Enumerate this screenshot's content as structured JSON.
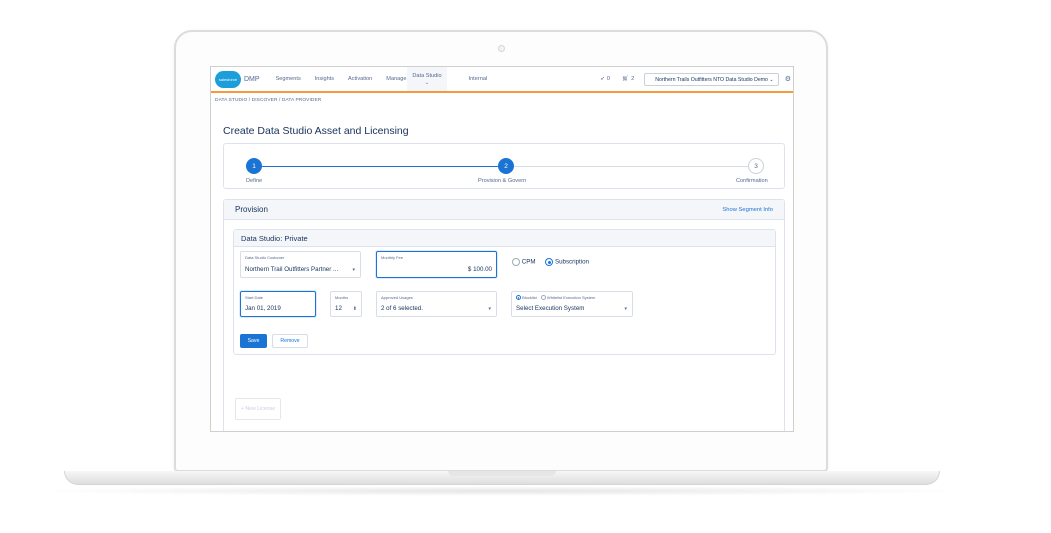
{
  "nav": {
    "app_name": "DMP",
    "logo_text": "salesforce",
    "items": [
      "Segments",
      "Insights",
      "Activation",
      "Manage"
    ],
    "active_item": "Data Studio",
    "after_active": "Internal",
    "notifications_count": "0",
    "cart_count": "2",
    "org": "Northern Trails Outfitters NTO Data Studio Demo"
  },
  "breadcrumb": "DATA STUDIO  /  DISCOVER  /  DATA PROVIDER",
  "page_title": "Create Data Studio Asset and Licensing",
  "steps": [
    {
      "number": "1",
      "label": "Define"
    },
    {
      "number": "2",
      "label": "Provision & Govern"
    },
    {
      "number": "3",
      "label": "Confirmation"
    }
  ],
  "provision": {
    "title": "Provision",
    "show_segment_info": "Show Segment Info",
    "card_title": "Data Studio: Private",
    "customer": {
      "label": "Data Studio Customer",
      "value": "Northern Trail Outfitters Partner ..."
    },
    "monthly_fee": {
      "label": "Monthly Fee",
      "value": "$ 100.00"
    },
    "pricing": {
      "cpm": "CPM",
      "subscription": "Subscription"
    },
    "start_date": {
      "label": "Start Date",
      "value": "Jan 01, 2019"
    },
    "months": {
      "label": "Months",
      "value": "12"
    },
    "approved_usages": {
      "label": "Approved Usages",
      "value": "2 of 6 selected."
    },
    "execution": {
      "blocklist": "Blocklist",
      "whitelist": "Whitelist Execution System",
      "value": "Select Execution System"
    },
    "save": "Save",
    "remove": "Remove",
    "new_license": "+ New License"
  },
  "colors": {
    "brand": "#1b74d4",
    "accent_orange": "#f59a3c",
    "text": "#16325c"
  }
}
